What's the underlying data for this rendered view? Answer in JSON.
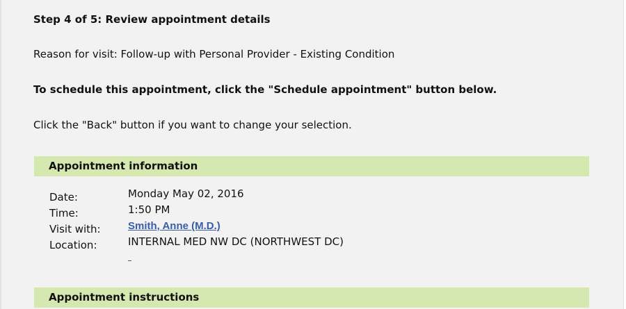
{
  "step": {
    "title": "Step 4 of 5: Review appointment details"
  },
  "reason_text": "Reason for visit: Follow-up with Personal Provider - Existing Condition",
  "instruction_text": "To schedule this appointment, click the \"Schedule appointment\" button below.",
  "back_note": "Click the \"Back\" button if you want to change your selection.",
  "appointment_info": {
    "header": "Appointment information",
    "date_label": "Date:",
    "date_value": "Monday May 02, 2016",
    "time_label": "Time:",
    "time_value": "1:50 PM",
    "visit_label": "Visit with:",
    "provider_name": "Smith, Anne (M.D.)",
    "location_label": "Location:",
    "location_value": "INTERNAL MED NW DC (NORTHWEST DC)"
  },
  "appointment_instructions": {
    "header": "Appointment instructions"
  },
  "colors": {
    "section_header_bg": "#d5e8b0",
    "link": "#3a5da8",
    "page_bg": "#f2f2f2"
  }
}
